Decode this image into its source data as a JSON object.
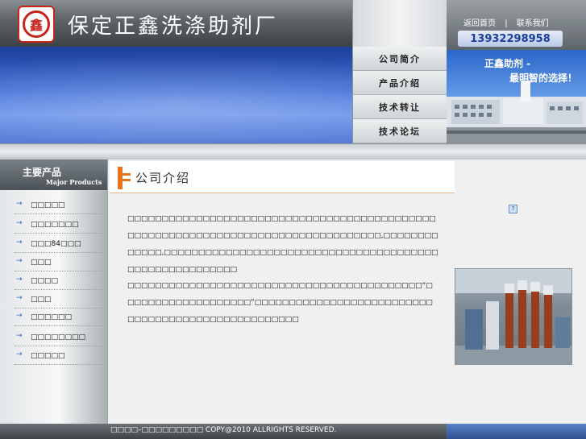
{
  "header": {
    "company_name": "保定正鑫洗涤助剂厂",
    "logo_char": "鑫",
    "nav": [
      "公司简介",
      "产品介绍",
      "技术转让",
      "技术论坛"
    ],
    "top_links": {
      "home": "返回首页",
      "separator": "|",
      "contact": "联系我们"
    },
    "phone": "13932298958",
    "banner_slogan_1": "正鑫助剂 -",
    "banner_slogan_2": "最明智的选择！"
  },
  "sidebar": {
    "title": "主要产品",
    "subtitle": "Major Products",
    "items": [
      "□□□□□",
      "□□□□□□□",
      "□□□84□□□",
      "□□□",
      "□□□□",
      "□□□",
      "□□□□□□",
      "□□□□□□□□",
      "□□□□□"
    ]
  },
  "main": {
    "section_title": "公司介绍",
    "paragraph_1": "□□□□□□□□□□□□□□□□□□□□□□□□□□□□□□□□□□□□□□□□□□□□□□□□□□□□□□□□□□□□□□□□□□□□□□□□□□□□□□□□□□,□□□□□□□□□□□□□,□□□□□□□□□□□□□□□□□□□□□□□□□□□□□□□□□□□□□□□□□□□□□□□□□□□□□□□□",
    "paragraph_2": "□□□□□□□□□□□□□□□□□□□□□□□□□□□□□□□□□□□□□□□□□□□“□□□□□□□□□□□□□□□□□□□”□□□□□□□□□□□□□□□□□□□□□□□□□□□□□□□□□□□□□□□□□□□□□□□□□□□"
  },
  "footer": {
    "text": "□□□□–□□□□□□□□□ COPY@2010 ALLRIGHTS RESERVED."
  },
  "colors": {
    "accent_orange": "#e8731f",
    "brand_blue": "#3f6ed6",
    "logo_red": "#c5231b"
  }
}
